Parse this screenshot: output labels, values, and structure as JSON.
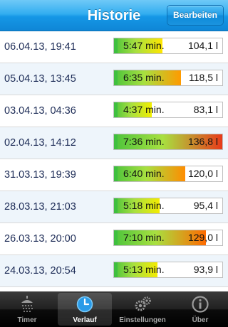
{
  "navbar": {
    "title": "Historie",
    "edit_label": "Bearbeiten"
  },
  "entries": [
    {
      "date": "06.04.13, 19:41",
      "duration": "5:47 min.",
      "volume": "104,1 l",
      "fill": 0.45,
      "end_color": "#ffe600"
    },
    {
      "date": "05.04.13, 13:45",
      "duration": "6:35 min.",
      "volume": "118,5 l",
      "fill": 0.62,
      "end_color": "#ff9a00"
    },
    {
      "date": "03.04.13, 04:36",
      "duration": "4:37 min.",
      "volume": "83,1 l",
      "fill": 0.35,
      "end_color": "#f2ee00"
    },
    {
      "date": "02.04.13, 14:12",
      "duration": "7:36 min.",
      "volume": "136,8 l",
      "fill": 1.0,
      "end_color": "#e83a1a"
    },
    {
      "date": "31.03.13, 19:39",
      "duration": "6:40 min.",
      "volume": "120,0 l",
      "fill": 0.66,
      "end_color": "#ff8c00"
    },
    {
      "date": "28.03.13, 21:03",
      "duration": "5:18 min.",
      "volume": "95,4 l",
      "fill": 0.42,
      "end_color": "#f5ec00"
    },
    {
      "date": "26.03.13, 20:00",
      "duration": "7:10 min.",
      "volume": "129,0 l",
      "fill": 0.85,
      "end_color": "#ff6a00"
    },
    {
      "date": "24.03.13, 20:54",
      "duration": "5:13 min.",
      "volume": "93,9 l",
      "fill": 0.4,
      "end_color": "#f5ec00"
    }
  ],
  "tabs": [
    {
      "label": "Timer",
      "icon": "shower-icon",
      "active": false
    },
    {
      "label": "Verlauf",
      "icon": "clock-icon",
      "active": true
    },
    {
      "label": "Einstellungen",
      "icon": "gears-icon",
      "active": false
    },
    {
      "label": "Über",
      "icon": "info-icon",
      "active": false
    }
  ]
}
